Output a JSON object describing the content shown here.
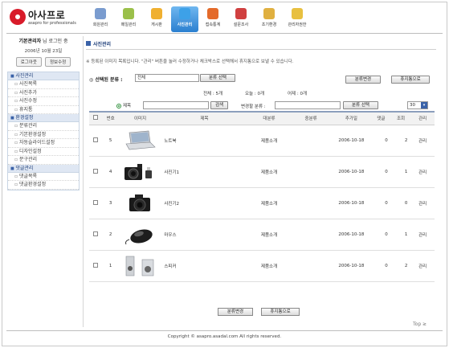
{
  "logo": {
    "name": "아사프로",
    "tagline": "asapro for professionals"
  },
  "topnav": [
    {
      "label": "회원관리",
      "color": "#7a9ccf"
    },
    {
      "label": "메일관리",
      "color": "#9bc04a"
    },
    {
      "label": "게시판",
      "color": "#f0b030"
    },
    {
      "label": "사진관리",
      "color": "#3da1e8"
    },
    {
      "label": "접속통계",
      "color": "#e46a2a"
    },
    {
      "label": "설문조사",
      "color": "#d04040"
    },
    {
      "label": "초기환경",
      "color": "#e0b040"
    },
    {
      "label": "관리자권한",
      "color": "#e8c040"
    }
  ],
  "sidebar": {
    "user": "기본관리자",
    "user_suffix": "님 로그인 중",
    "date": "2006년 10월 23일",
    "logout": "로그아웃",
    "edit_info": "정보수정",
    "groups": [
      {
        "head": "사진관리",
        "items": [
          "사진목록",
          "사진추가",
          "사진수정",
          "휴지통"
        ]
      },
      {
        "head": "환경설정",
        "items": [
          "분류관리",
          "기본환경설정",
          "자동슬라이드설정",
          "디자인설정",
          "문구관리"
        ]
      },
      {
        "head": "댓글관리",
        "items": [
          "댓글목록",
          "댓글환경설정"
        ]
      }
    ]
  },
  "content": {
    "title": "사진관리",
    "notice": "※ 등록된 이미지 목록입니다. \"관리\" 버튼을 눌러 수정하거나 체크박스로 선택해서 휴지통으로 보낼 수 있습니다.",
    "category_label": "◎ 선택된 분류 :",
    "category_value": "전체",
    "category_select_btn": "분류 선택",
    "change_category_btn": "분류변경",
    "trash_btn": "휴지통으로",
    "total": "전체 : 5개",
    "today": "오늘 : 0개",
    "yesterday": "어제 : 0개",
    "search_field_label": "제목",
    "search_btn": "검색",
    "change_to_label": "변경할 분류 :",
    "change_category_select_btn": "분류 선택",
    "page_size": "30"
  },
  "table": {
    "headers": [
      "",
      "번호",
      "이미지",
      "제목",
      "대분류",
      "중분류",
      "추가일",
      "댓글",
      "조회",
      "관리"
    ],
    "rows": [
      {
        "no": "5",
        "thumb": "laptop",
        "title": "노트북",
        "cat1": "제품소개",
        "cat2": "",
        "date": "2006-10-18",
        "comments": "0",
        "views": "2",
        "manage": "관리"
      },
      {
        "no": "4",
        "thumb": "camera-set",
        "title": "사진기1",
        "cat1": "제품소개",
        "cat2": "",
        "date": "2006-10-18",
        "comments": "0",
        "views": "1",
        "manage": "관리"
      },
      {
        "no": "3",
        "thumb": "camera",
        "title": "사진기2",
        "cat1": "제품소개",
        "cat2": "",
        "date": "2006-10-18",
        "comments": "0",
        "views": "0",
        "manage": "관리"
      },
      {
        "no": "2",
        "thumb": "mouse",
        "title": "마우스",
        "cat1": "제품소개",
        "cat2": "",
        "date": "2006-10-18",
        "comments": "0",
        "views": "1",
        "manage": "관리"
      },
      {
        "no": "1",
        "thumb": "speakers",
        "title": "스피커",
        "cat1": "제품소개",
        "cat2": "",
        "date": "2006-10-18",
        "comments": "0",
        "views": "2",
        "manage": "관리"
      }
    ]
  },
  "bottom": {
    "change_category_btn": "분류변경",
    "trash_btn": "휴지통으로"
  },
  "top_link": "Top ≳",
  "footer": "Copyright © asapro.asadal.com All rights reserved."
}
